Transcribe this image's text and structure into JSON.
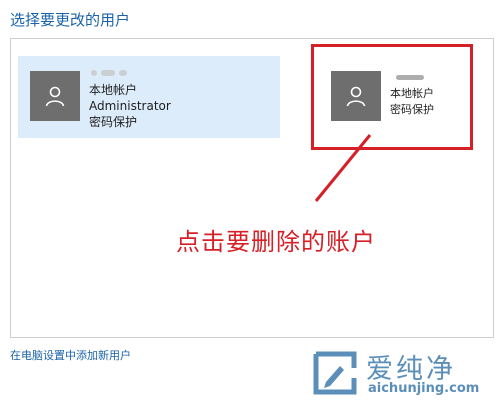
{
  "page": {
    "title": "选择要更改的用户"
  },
  "accounts": [
    {
      "name": "",
      "type": "本地帐户",
      "role": "Administrator",
      "protection": "密码保护",
      "selected": true
    },
    {
      "name": "",
      "type": "本地帐户",
      "protection": "密码保护",
      "selected": false
    }
  ],
  "annotation": {
    "text": "点击要删除的账户"
  },
  "footer": {
    "add_user_link": "在电脑设置中添加新用户"
  },
  "watermark": {
    "title": "爱纯净",
    "url": "aichunjing.com"
  },
  "colors": {
    "accent": "#1a63a8",
    "highlight": "#d61f26",
    "avatar_bg": "#6e6e6e",
    "selected_bg": "#dcecfb",
    "watermark": "#5b8fb9"
  },
  "icons": {
    "avatar": "user-icon",
    "watermark_logo": "aichunjing-logo-icon"
  }
}
